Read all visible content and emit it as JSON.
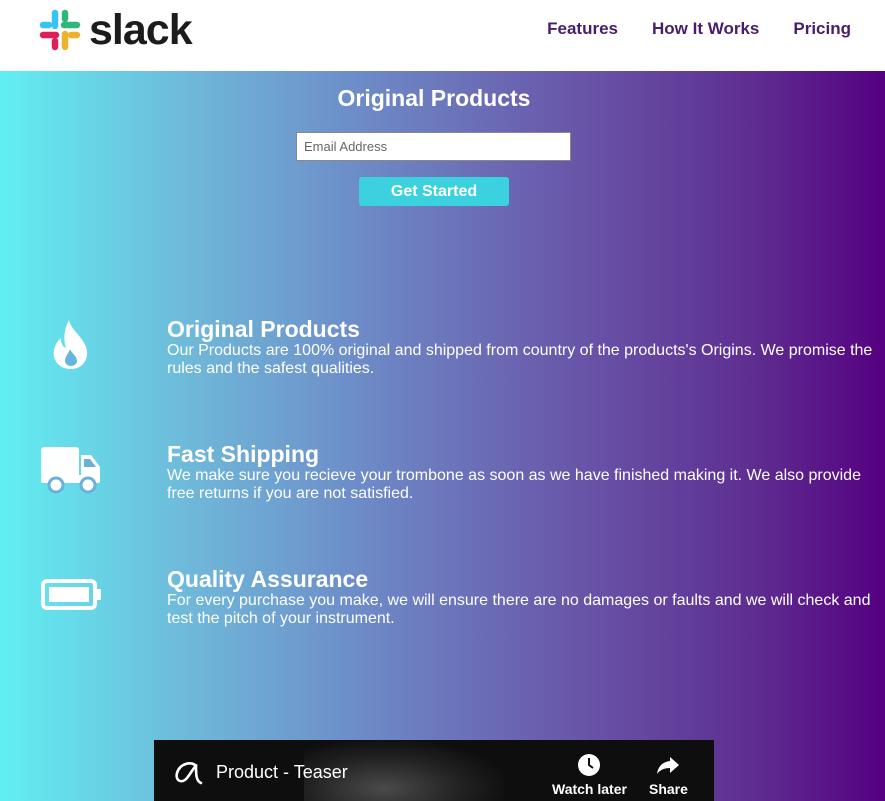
{
  "header": {
    "brand": "slack",
    "nav": [
      {
        "label": "Features"
      },
      {
        "label": "How It Works"
      },
      {
        "label": "Pricing"
      }
    ]
  },
  "hero": {
    "title": "Original Products",
    "email_placeholder": "Email Address",
    "cta_label": "Get Started"
  },
  "features": [
    {
      "icon": "fire-icon",
      "title": "Original Products",
      "text": "Our Products are 100% original and shipped from country of the products's Origins. We promise the rules and the safest qualities."
    },
    {
      "icon": "truck-icon",
      "title": "Fast Shipping",
      "text": "We make sure you recieve your trombone as soon as we have finished making it. We also provide free returns if you are not satisfied."
    },
    {
      "icon": "battery-icon",
      "title": "Quality Assurance",
      "text": "For every purchase you make, we will ensure there are no damages or faults and we will check and test the pitch of your instrument."
    }
  ],
  "video": {
    "title": "Product - Teaser",
    "watch_later": "Watch later",
    "share": "Share"
  },
  "colors": {
    "nav_text": "#4a1d6b",
    "cta_bg": "#3bd1de",
    "gradient_start": "#61eff2",
    "gradient_end": "#550081"
  }
}
